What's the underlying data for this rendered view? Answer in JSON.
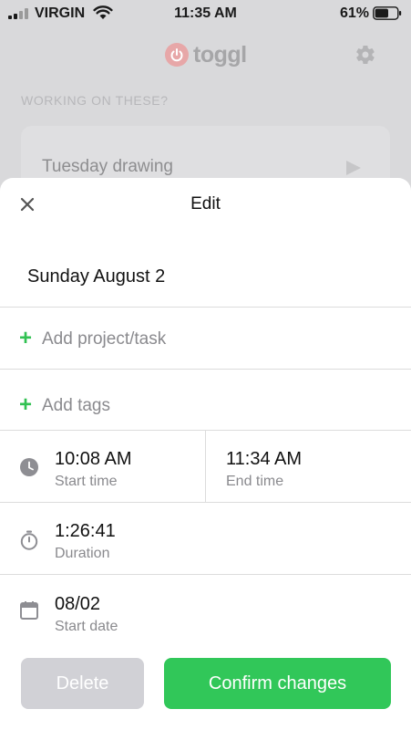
{
  "status_bar": {
    "carrier": "VIRGIN",
    "time": "11:35 AM",
    "battery": "61%",
    "battery_level": 0.61
  },
  "background_app": {
    "brand": "toggl",
    "section_heading": "WORKING ON THESE?",
    "suggestion_title": "Tuesday drawing"
  },
  "edit_sheet": {
    "title": "Edit",
    "date_heading": "Sunday August 2",
    "add_project_label": "Add project/task",
    "add_tags_label": "Add tags",
    "start_time": {
      "value": "10:08 AM",
      "label": "Start time"
    },
    "end_time": {
      "value": "11:34 AM",
      "label": "End time"
    },
    "duration": {
      "value": "1:26:41",
      "label": "Duration"
    },
    "start_date": {
      "value": "08/02",
      "label": "Start date"
    },
    "delete_label": "Delete",
    "confirm_label": "Confirm changes"
  },
  "colors": {
    "accent_green": "#31c759",
    "plus_green": "#31c152",
    "disabled_button": "#d1d1d6",
    "brand_logo": "#e7a7a8"
  },
  "icons": [
    "signal-icon",
    "wifi-icon",
    "battery-icon",
    "toggl-logo-icon",
    "gear-icon",
    "play-icon",
    "close-icon",
    "plus-icon",
    "clock-icon",
    "stopwatch-icon",
    "calendar-icon"
  ]
}
